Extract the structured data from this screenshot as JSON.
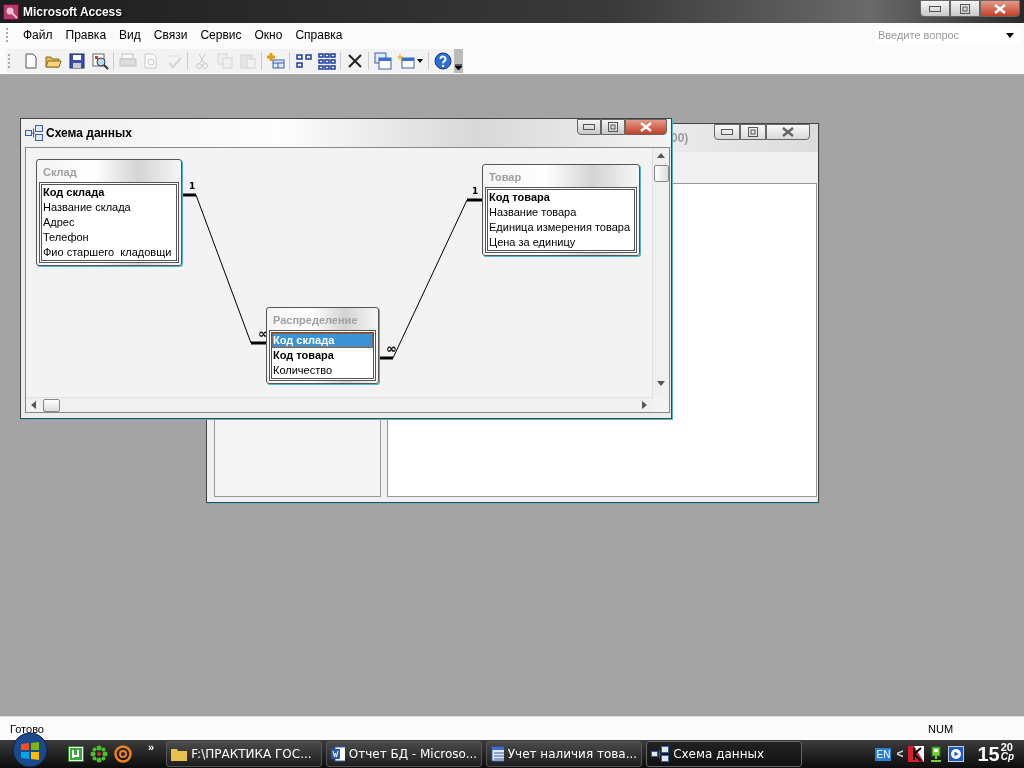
{
  "window": {
    "title": "Microsoft Access"
  },
  "menu": [
    {
      "label": "Файл"
    },
    {
      "label": "Правка"
    },
    {
      "label": "Вид"
    },
    {
      "label": "Связи"
    },
    {
      "label": "Сервис"
    },
    {
      "label": "Окно"
    },
    {
      "label": "Справка"
    }
  ],
  "help_search": {
    "placeholder": "Введите вопрос"
  },
  "toolbar": [
    {
      "disabled": false
    },
    {
      "disabled": false
    },
    {
      "disabled": false
    },
    {
      "disabled": false
    },
    {
      "disabled": true
    },
    {
      "disabled": true
    },
    {
      "disabled": true
    },
    {
      "disabled": true
    },
    {
      "disabled": true
    },
    {
      "disabled": true
    },
    {
      "disabled": false
    },
    {
      "disabled": false
    },
    {
      "disabled": false
    },
    {
      "disabled": false
    },
    {
      "disabled": false
    },
    {
      "disabled": false
    },
    {
      "disabled": false
    }
  ],
  "back_window": {
    "title": "00)"
  },
  "diagram_window": {
    "title": "Схема данных",
    "tables": [
      {
        "name": "Склад",
        "fields": [
          {
            "name": "Код склада",
            "key": true,
            "selected": false
          },
          {
            "name": "Название склада",
            "key": false,
            "selected": false
          },
          {
            "name": "Адрес",
            "key": false,
            "selected": false
          },
          {
            "name": "Телефон",
            "key": false,
            "selected": false
          },
          {
            "name": "Фио старшего  кладовщи",
            "key": false,
            "selected": false
          }
        ]
      },
      {
        "name": "Товар",
        "fields": [
          {
            "name": "Код товара",
            "key": true,
            "selected": false
          },
          {
            "name": "Название товара",
            "key": false,
            "selected": false
          },
          {
            "name": "Единица измерения товара",
            "key": false,
            "selected": false
          },
          {
            "name": "Цена за единицу",
            "key": false,
            "selected": false
          }
        ]
      },
      {
        "name": "Распределение",
        "fields": [
          {
            "name": "Код склада",
            "key": true,
            "selected": true
          },
          {
            "name": "Код товара",
            "key": true,
            "selected": false
          },
          {
            "name": "Количество",
            "key": false,
            "selected": false
          }
        ]
      }
    ],
    "relationships": [
      {
        "one_label": "1",
        "many_label": "∞"
      },
      {
        "one_label": "1",
        "many_label": "∞"
      }
    ]
  },
  "status_bar": {
    "text": "Готово",
    "indicator": "NUM"
  },
  "taskbar": {
    "overflow": "»",
    "buttons": [
      {
        "label": "F:\\ПРАКТИКА ГОС...",
        "selected": false
      },
      {
        "label": "Отчет БД - Microso...",
        "selected": false
      },
      {
        "label": "Учет наличия това...",
        "selected": false
      },
      {
        "label": "Схема данных",
        "selected": true
      }
    ],
    "language": "EN",
    "tray_arrow": "<",
    "clock_hour": "15",
    "clock_minute": "20",
    "clock_day": "Ср"
  }
}
